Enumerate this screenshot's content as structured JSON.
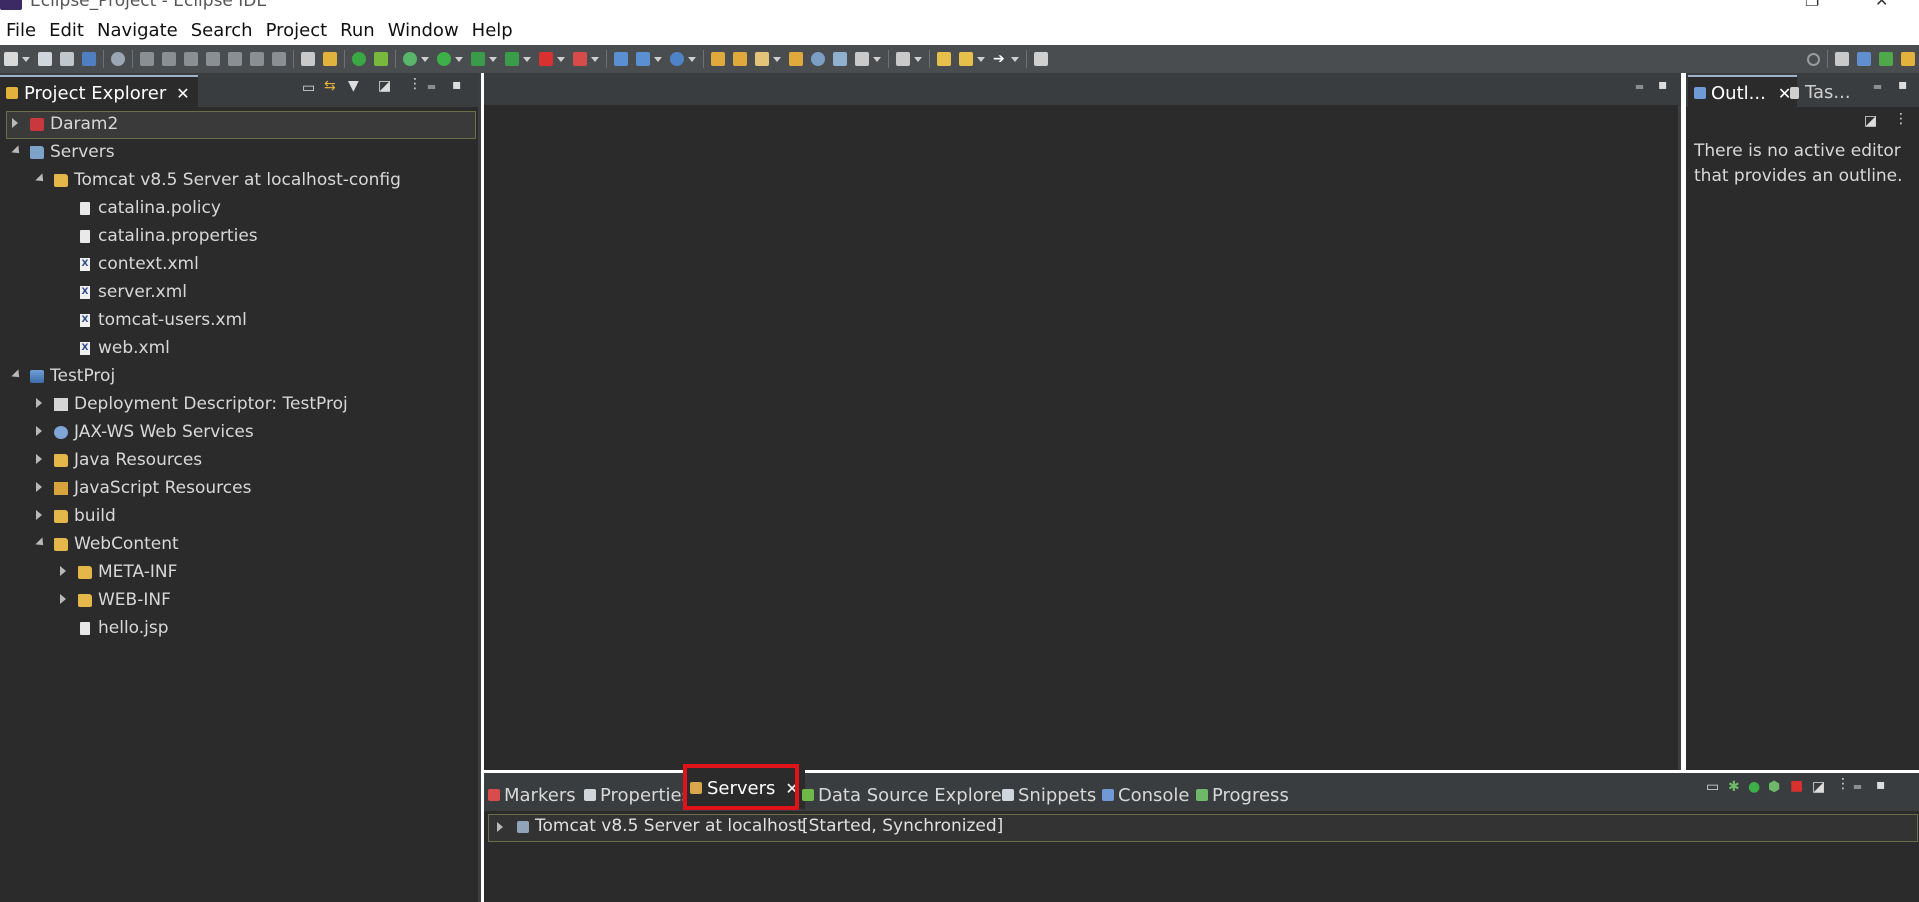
{
  "window": {
    "title": "Eclipse_Project - Eclipse IDE"
  },
  "menu": [
    "File",
    "Edit",
    "Navigate",
    "Search",
    "Project",
    "Run",
    "Window",
    "Help"
  ],
  "project_explorer": {
    "tab_label": "Project Explorer",
    "items": [
      {
        "label": "Daram2"
      },
      {
        "label": "Servers"
      },
      {
        "label": "Tomcat v8.5 Server at localhost-config"
      },
      {
        "label": "catalina.policy"
      },
      {
        "label": "catalina.properties"
      },
      {
        "label": "context.xml"
      },
      {
        "label": "server.xml"
      },
      {
        "label": "tomcat-users.xml"
      },
      {
        "label": "web.xml"
      },
      {
        "label": "TestProj"
      },
      {
        "label": "Deployment Descriptor: TestProj"
      },
      {
        "label": "JAX-WS Web Services"
      },
      {
        "label": "Java Resources"
      },
      {
        "label": "JavaScript Resources"
      },
      {
        "label": "build"
      },
      {
        "label": "WebContent"
      },
      {
        "label": "META-INF"
      },
      {
        "label": "WEB-INF"
      },
      {
        "label": "hello.jsp"
      }
    ]
  },
  "outline": {
    "tab_label": "Outl...",
    "task_tab_label": "Tas...",
    "message": "There is no active editor that provides an outline."
  },
  "bottom_panel": {
    "tabs": [
      {
        "label": "Markers"
      },
      {
        "label": "Properties"
      },
      {
        "label": "Servers"
      },
      {
        "label": "Data Source Explorer"
      },
      {
        "label": "Snippets"
      },
      {
        "label": "Console"
      },
      {
        "label": "Progress"
      }
    ],
    "server_entry": {
      "name": "Tomcat v8.5 Server at localhost",
      "status": "[Started, Synchronized]"
    }
  },
  "colors": {
    "highlight_box": "#e0121a",
    "dark_bg": "#2b2b2b",
    "toolbar_bg": "#4a4d4f"
  }
}
